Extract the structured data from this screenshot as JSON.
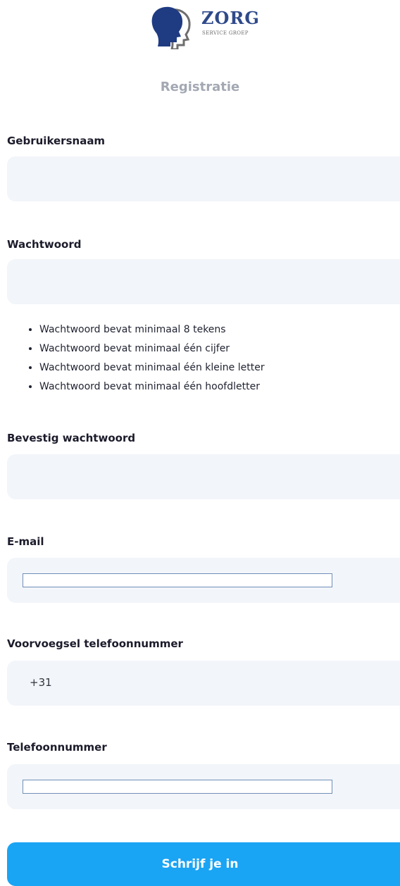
{
  "brand": {
    "name": "ZORG",
    "subtitle": "SERVICE GROEP",
    "logo_icon": "two-heads-profile-icon",
    "colors": {
      "primary_head": "#1f3b82",
      "secondary_head": "#6e6e6e",
      "name": "#2f4a8a"
    }
  },
  "page": {
    "title": "Registratie"
  },
  "form": {
    "username": {
      "label": "Gebruikersnaam",
      "value": ""
    },
    "password": {
      "label": "Wachtwoord",
      "value": ""
    },
    "password_rules": [
      "Wachtwoord bevat minimaal 8 tekens",
      "Wachtwoord bevat minimaal één cijfer",
      "Wachtwoord bevat minimaal één kleine letter",
      "Wachtwoord bevat minimaal één hoofdletter"
    ],
    "confirm_password": {
      "label": "Bevestig wachtwoord",
      "value": ""
    },
    "email": {
      "label": "E-mail",
      "value": ""
    },
    "phone_prefix": {
      "label": "Voorvoegsel telefoonnummer",
      "value": "+31"
    },
    "phone": {
      "label": "Telefoonnummer",
      "value": ""
    },
    "submit_label": "Schrijf je in"
  },
  "colors": {
    "field_background": "#f2f5f9",
    "button_background": "#1aa4f4",
    "title_color": "#a3a8b3"
  }
}
